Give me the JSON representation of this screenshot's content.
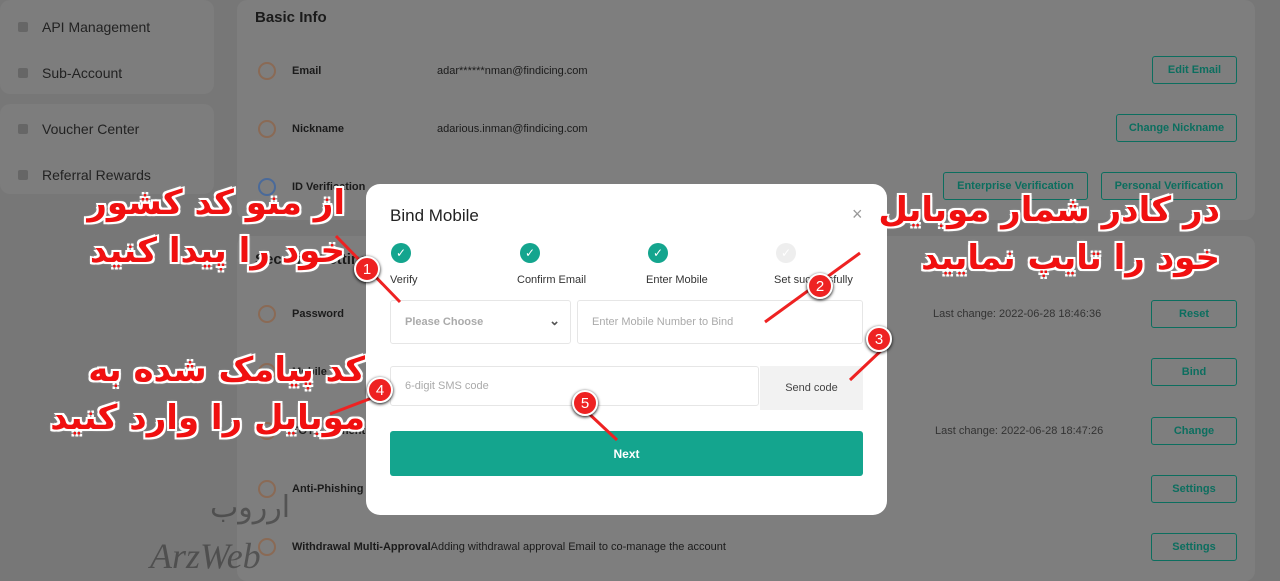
{
  "sidebar": {
    "items": [
      {
        "label": "API Management"
      },
      {
        "label": "Sub-Account"
      },
      {
        "label": "Voucher Center"
      },
      {
        "label": "Referral Rewards"
      }
    ]
  },
  "basic_info": {
    "title": "Basic Info",
    "rows": [
      {
        "label": "Email",
        "value": "adar******nman@findicing.com",
        "buttons": [
          "Edit Email"
        ]
      },
      {
        "label": "Nickname",
        "value": "adarious.inman@findicing.com",
        "buttons": [
          "Change Nickname"
        ]
      },
      {
        "label": "ID Verification",
        "value": "",
        "buttons": [
          "Enterprise Verification",
          "Personal Verification"
        ]
      }
    ]
  },
  "security": {
    "title": "Security Settings",
    "rows": [
      {
        "label": "Password",
        "meta": "Last change: 2022-06-28 18:46:36",
        "button": "Reset"
      },
      {
        "label": "Mobile",
        "meta": "",
        "button": "Bind"
      },
      {
        "label": "TOTP Authenticator",
        "meta": "Last change: 2022-06-28 18:47:26",
        "button": "Change"
      },
      {
        "label": "Anti-Phishing Code",
        "meta": "",
        "button": "Settings"
      },
      {
        "label": "Withdrawal Multi-Approval",
        "meta": "Adding withdrawal approval Email to co-manage the account",
        "button": "Settings"
      }
    ]
  },
  "modal": {
    "title": "Bind Mobile",
    "steps": [
      {
        "label": "Verify",
        "done": true
      },
      {
        "label": "Confirm Email",
        "done": true
      },
      {
        "label": "Enter Mobile",
        "done": true
      },
      {
        "label": "Set successfully",
        "done": false
      }
    ],
    "country_placeholder": "Please Choose",
    "mobile_placeholder": "Enter Mobile Number to Bind",
    "sms_placeholder": "6-digit SMS code",
    "send_code": "Send code",
    "next": "Next"
  },
  "annotations": {
    "a1": [
      "از منو کد کشور",
      "خود را پیدا کنید"
    ],
    "a2": [
      "در کادر شمار موبایل",
      "خود را تایپ نمایید"
    ],
    "a4": [
      "کد پیامک شده به",
      "موبایل را وارد کنید"
    ],
    "badges": [
      "1",
      "2",
      "3",
      "4",
      "5"
    ]
  },
  "watermark": {
    "fa": "اررﻭب",
    "en": "ArzWeb"
  },
  "colors": {
    "accent": "#14a58e",
    "annotation": "#f01010"
  }
}
